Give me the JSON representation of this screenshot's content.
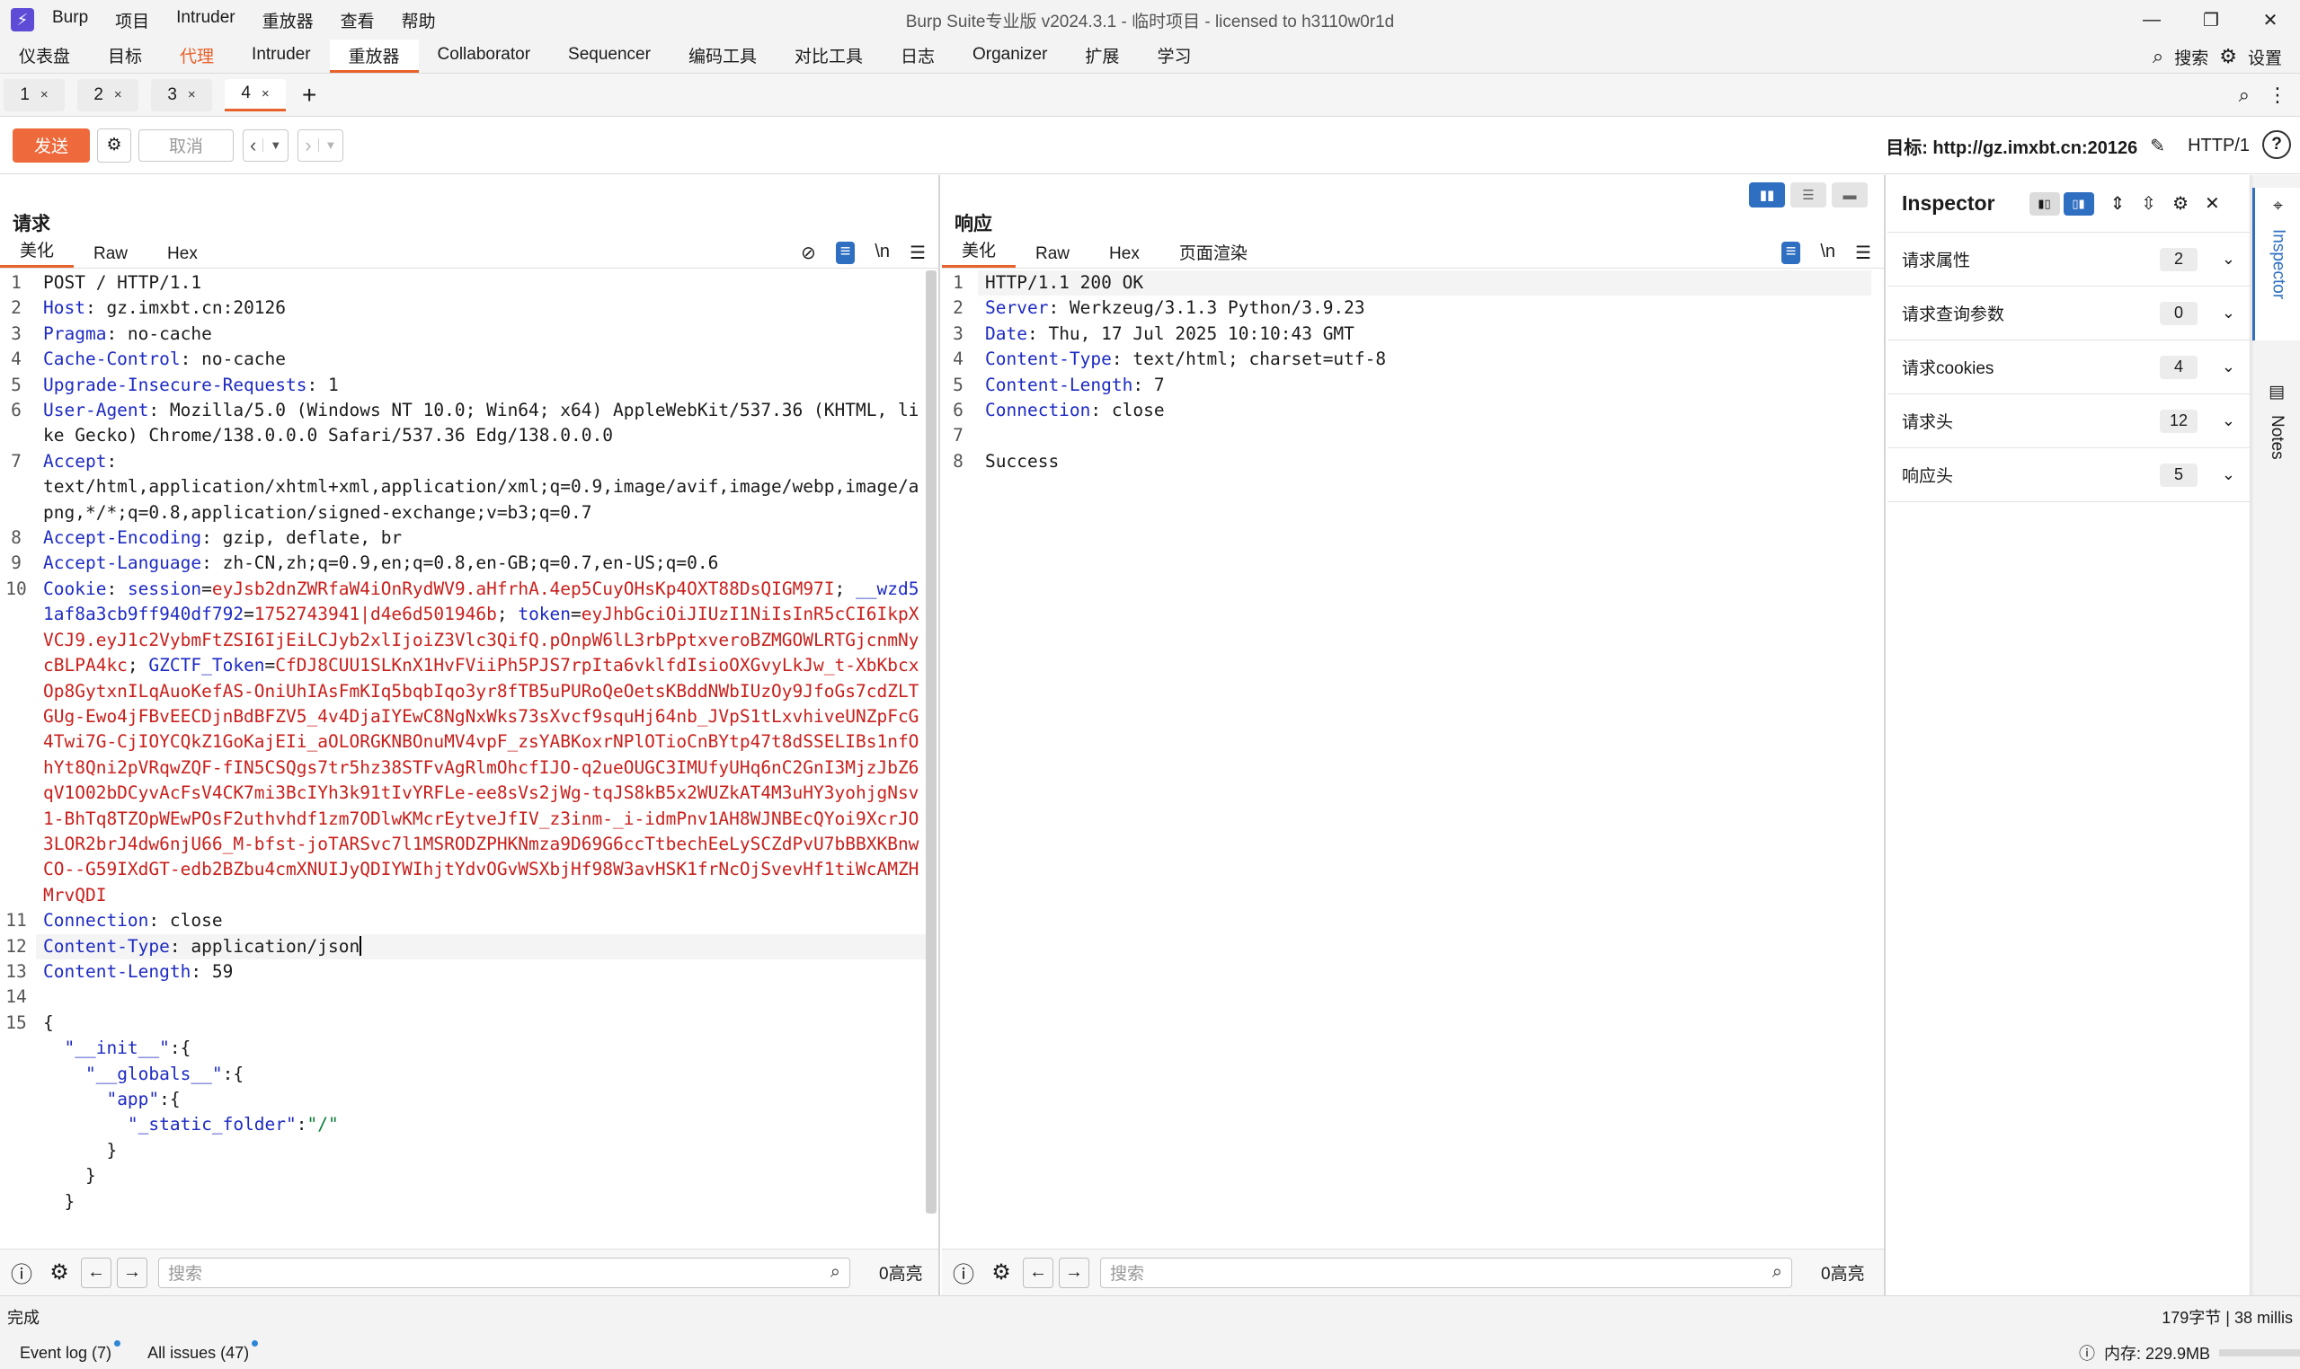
{
  "titlebar": {
    "logo": "⚡",
    "menu": [
      "Burp",
      "项目",
      "Intruder",
      "重放器",
      "查看",
      "帮助"
    ],
    "title": "Burp Suite专业版  v2024.3.1 - 临时项目 - licensed to h3110w0r1d"
  },
  "tooltabs": {
    "tabs": [
      "仪表盘",
      "目标",
      "代理",
      "Intruder",
      "重放器",
      "Collaborator",
      "Sequencer",
      "编码工具",
      "对比工具",
      "日志",
      "Organizer",
      "扩展",
      "学习"
    ],
    "active_index": 4,
    "highlight_index": 2,
    "search_label": "搜索",
    "settings_label": "设置"
  },
  "repeater_tabs": {
    "tabs": [
      "1",
      "2",
      "3",
      "4"
    ],
    "active_index": 3,
    "close_glyph": "×",
    "add_glyph": "+"
  },
  "sendbar": {
    "send_label": "发送",
    "cancel_label": "取消",
    "target_label": "目标: http://gz.imxbt.cn:20126",
    "http_version": "HTTP/1"
  },
  "request": {
    "title": "请求",
    "tabs": [
      "美化",
      "Raw",
      "Hex"
    ],
    "search_placeholder": "搜索",
    "highlights": "0高亮"
  },
  "response": {
    "title": "响应",
    "tabs": [
      "美化",
      "Raw",
      "Hex",
      "页面渲染"
    ],
    "search_placeholder": "搜索",
    "highlights": "0高亮"
  },
  "inspector": {
    "title": "Inspector",
    "rows": [
      {
        "label": "请求属性",
        "count": "2"
      },
      {
        "label": "请求查询参数",
        "count": "0"
      },
      {
        "label": "请求cookies",
        "count": "4"
      },
      {
        "label": "请求头",
        "count": "12"
      },
      {
        "label": "响应头",
        "count": "5"
      }
    ]
  },
  "rail": {
    "inspector": "Inspector",
    "notes": "Notes"
  },
  "status": {
    "left": "完成",
    "right": "179字节 | 38 millis",
    "event_log": "Event log (7)",
    "all_issues": "All issues (47)",
    "memory": "内存: 229.9MB"
  },
  "colors": {
    "accent": "#e8622c",
    "blue": "#2f6fc2",
    "header_key": "#1d2ac2",
    "cookie_value": "#c8201c"
  }
}
